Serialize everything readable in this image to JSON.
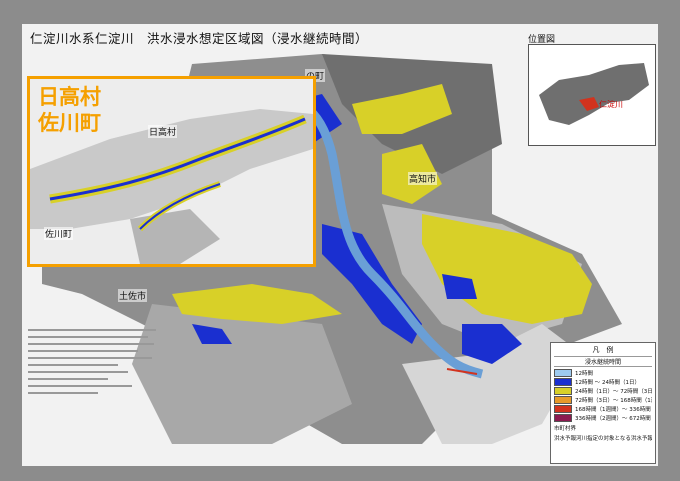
{
  "map": {
    "title": "仁淀川水系仁淀川　洪水浸水想定区域図（浸水継続時間）",
    "location_map_title": "位置図",
    "location_map_label": "仁淀川",
    "place_names": {
      "top_town": "の町",
      "kochi": "高知市",
      "tosa": "土佐市"
    },
    "zoom_inset": {
      "label_line1": "日高村",
      "label_line2": "佐川町",
      "place_hidaka": "日高村",
      "place_sakawa": "佐川町",
      "border_color": "#f5a000"
    },
    "colors": {
      "river": "#6a9fd6",
      "deep_flood": "#1a2fd0",
      "yellow_flood": "#d8d028",
      "terrain_dark": "#7f7f7f",
      "terrain_light": "#bdbdbd"
    }
  },
  "legend": {
    "title": "凡　例",
    "subtitle": "浸水継続時間",
    "items": [
      {
        "color": "#9ecbf0",
        "label": "12時間"
      },
      {
        "color": "#1a2fd0",
        "label": "12時間 ～ 24時間（1日）"
      },
      {
        "color": "#d8d028",
        "label": "24時間（1日）～ 72時間（3日）"
      },
      {
        "color": "#e79a2a",
        "label": "72時間（3日）～ 168時間（1週間）"
      },
      {
        "color": "#d2331e",
        "label": "168時間（1週間）～ 336時間（2週間）"
      },
      {
        "color": "#8c1a50",
        "label": "336時間（2週間）～ 672時間（4週間）"
      }
    ],
    "footer_1": "市町村界",
    "footer_2": "洪水予報河川指定の対象となる洪水予報区間"
  }
}
